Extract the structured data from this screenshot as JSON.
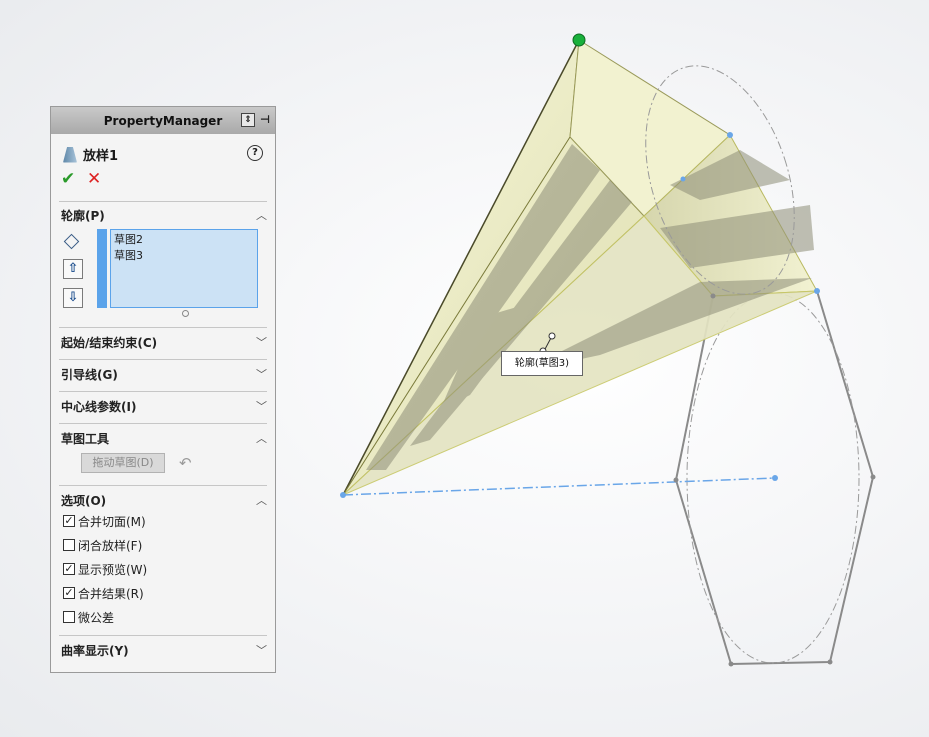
{
  "property_manager": {
    "title": "PropertyManager",
    "feature_name": "放样1",
    "feature_icon": "loft-icon",
    "header_icons": [
      "expand-icon",
      "pin-icon"
    ]
  },
  "sections": {
    "profiles": {
      "label": "轮廓(P)",
      "items": [
        "草图2",
        "草图3"
      ],
      "state": "expanded"
    },
    "start_end_constraints": {
      "label": "起始/结束约束(C)",
      "state": "collapsed"
    },
    "guide_curves": {
      "label": "引导线(G)",
      "state": "collapsed"
    },
    "centerline_params": {
      "label": "中心线参数(I)",
      "state": "collapsed"
    },
    "sketch_tools": {
      "label": "草图工具",
      "state": "expanded",
      "drag_button": "拖动草图(D)"
    },
    "options": {
      "label": "选项(O)",
      "state": "expanded",
      "items": [
        {
          "label": "合并切面(M)",
          "checked": true
        },
        {
          "label": "闭合放样(F)",
          "checked": false
        },
        {
          "label": "显示预览(W)",
          "checked": true
        },
        {
          "label": "合并结果(R)",
          "checked": true
        },
        {
          "label": "微公差",
          "checked": false
        }
      ]
    },
    "curvature_display": {
      "label": "曲率显示(Y)",
      "state": "collapsed"
    }
  },
  "viewport": {
    "tooltip": "轮廓(草图3)"
  },
  "colors": {
    "accent_blue": "#5ba3ea",
    "selection_bg": "#cce2f5",
    "ok_green": "#2a9a2a",
    "cancel_red": "#d22222",
    "loft_surface": "#efefc4",
    "sketch_line": "#8a8a8a",
    "centerline": "#6aa6e8"
  }
}
